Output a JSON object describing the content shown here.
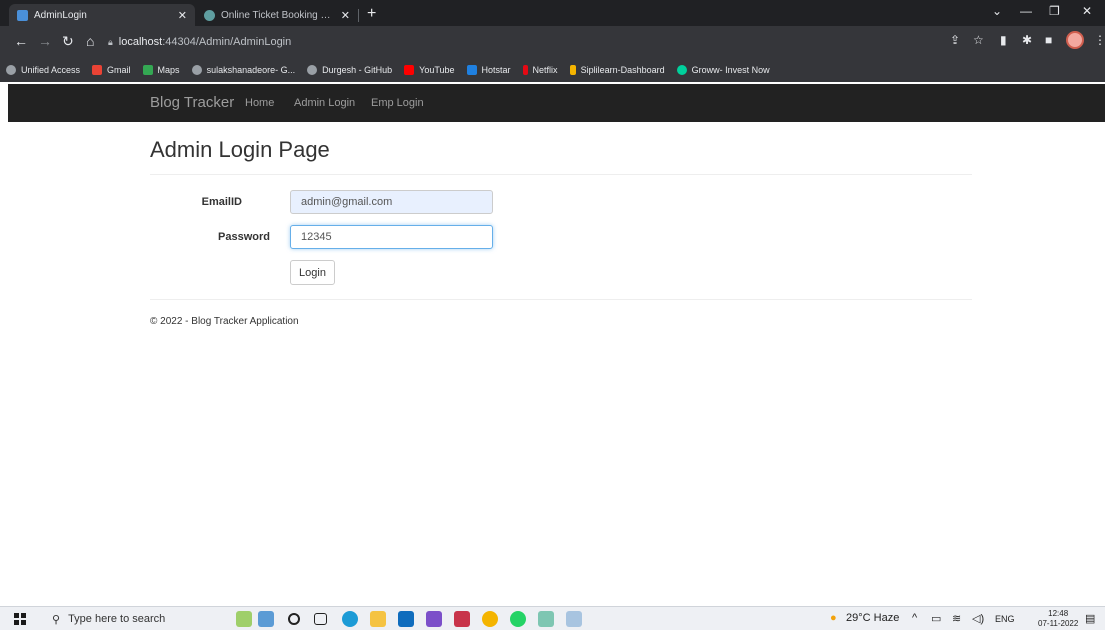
{
  "browser": {
    "tabs": [
      {
        "title": "AdminLogin",
        "active": true
      },
      {
        "title": "Online Ticket Booking Offers, Bu",
        "active": false
      }
    ],
    "url_host": "localhost",
    "url_path": ":44304/Admin/AdminLogin",
    "bookmarks": [
      {
        "label": "Unified Access",
        "color": "#9aa0a6"
      },
      {
        "label": "Gmail",
        "color": "#ea4335"
      },
      {
        "label": "Maps",
        "color": "#34a853"
      },
      {
        "label": "sulakshanadeore- G...",
        "color": "#9aa0a6"
      },
      {
        "label": "Durgesh - GitHub",
        "color": "#9aa0a6"
      },
      {
        "label": "YouTube",
        "color": "#ff0000"
      },
      {
        "label": "Hotstar",
        "color": "#1f80e0"
      },
      {
        "label": "Netflix",
        "color": "#e50914"
      },
      {
        "label": "Siplilearn-Dashboard",
        "color": "#f5b400"
      },
      {
        "label": "Groww- Invest Now",
        "color": "#00d09c"
      }
    ]
  },
  "navbar": {
    "brand": "Blog Tracker",
    "links": [
      "Home",
      "Admin Login",
      "Emp Login"
    ]
  },
  "page": {
    "title": "Admin Login Page",
    "email_label": "EmailID",
    "email_value": "admin@gmail.com",
    "password_label": "Password",
    "password_value": "12345",
    "login_label": "Login",
    "footer": "© 2022 - Blog Tracker Application"
  },
  "taskbar": {
    "search_placeholder": "Type here to search",
    "weather": "29°C Haze",
    "language": "ENG",
    "time": "12:48",
    "date": "07-11-2022"
  }
}
